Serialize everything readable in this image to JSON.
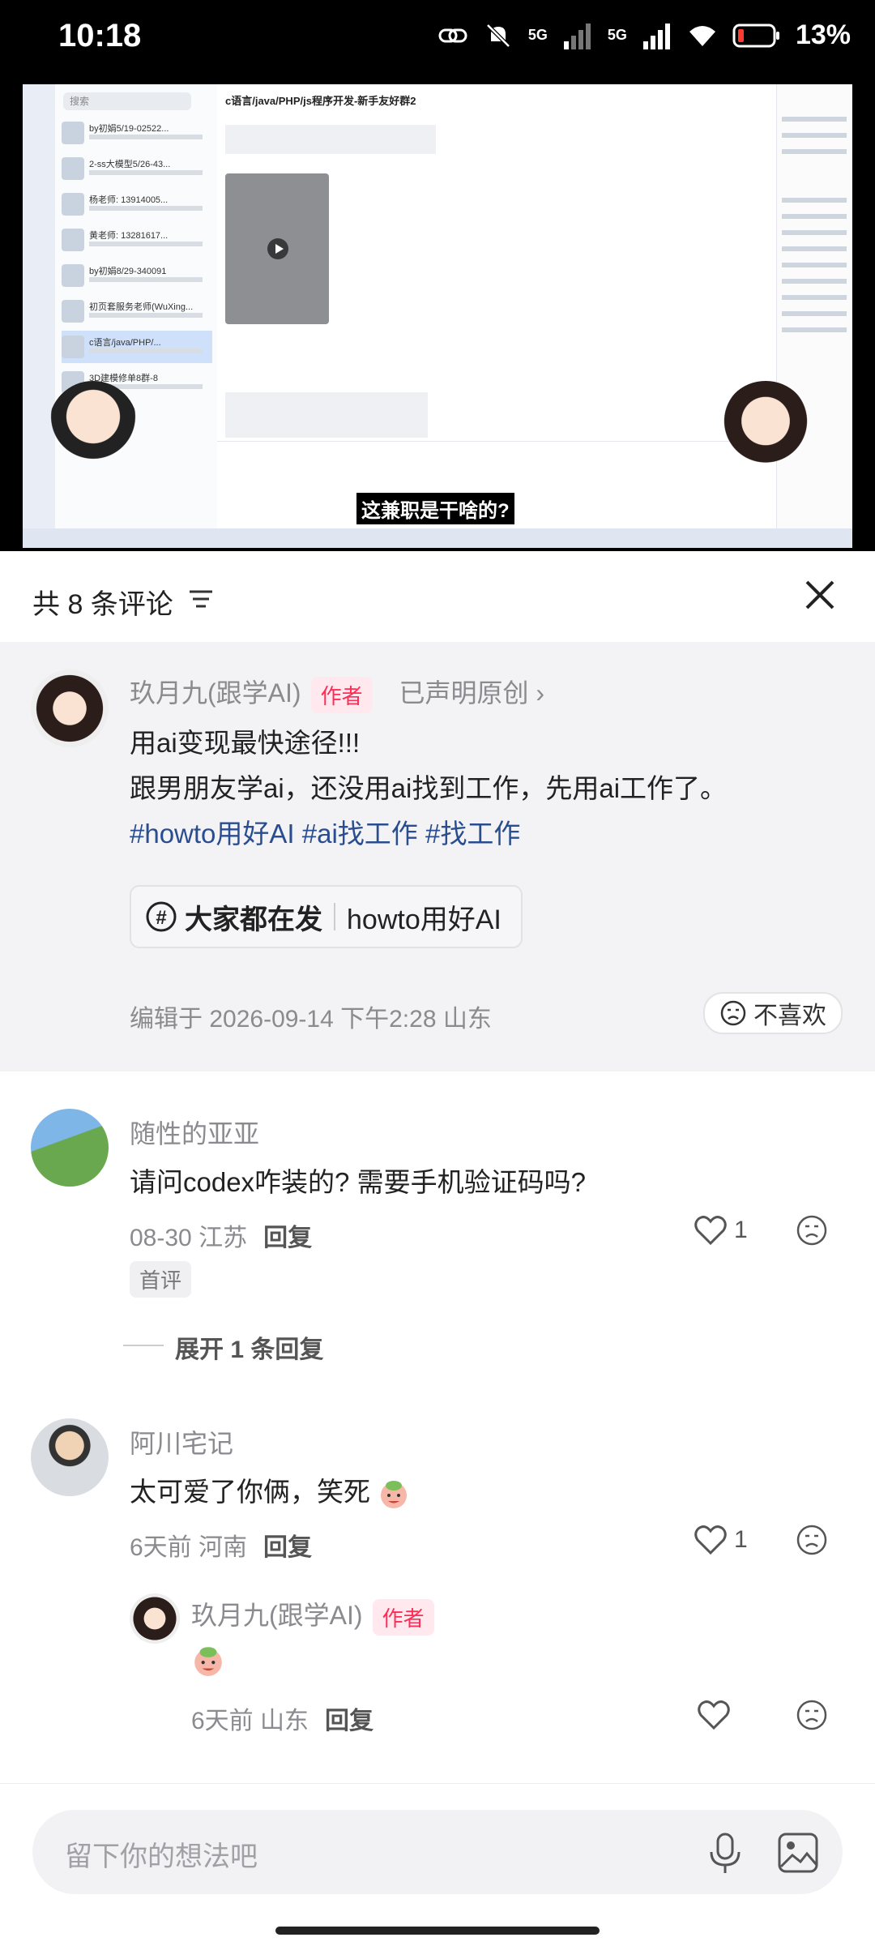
{
  "status_bar": {
    "time": "10:18",
    "battery": "13%",
    "network_1": "5G",
    "network_2": "5G"
  },
  "video": {
    "caption": "这兼职是干啥的?",
    "screen": {
      "search_placeholder": "搜索",
      "window_title": "c语言/java/PHP/js程序开发-新手友好群2",
      "chats": [
        "by初娟5/19-02522...",
        "2-ss大模型5/26-43...",
        "杨老师: 13914005...",
        "黄老师: 13281617...",
        "by初娟8/29-340091",
        "初页套服务老师(WuXing...",
        "c语言/java/PHP/...",
        "3D建模修单8群-8"
      ]
    }
  },
  "comments_panel": {
    "title": "共 8 条评论",
    "post": {
      "author": "玖月九(跟学AI)",
      "author_tag": "作者",
      "original_label": "已声明原创",
      "line1": "用ai变现最快途径!!!",
      "line2": "跟男朋友学ai，还没用ai找到工作，先用ai工作了。",
      "hashtags": "#howto用好AI #ai找工作 #找工作",
      "chip_bold": "大家都在发",
      "chip_topic": "howto用好AI",
      "edited": "编辑于 2026-09-14 下午2:28 山东",
      "dislike_label": "不喜欢"
    },
    "comments": [
      {
        "user": "随性的亚亚",
        "text": "请问codex咋装的? 需要手机验证码吗?",
        "meta": "08-30 江苏",
        "reply_label": "回复",
        "likes": "1",
        "badge": "首评",
        "expand": "展开 1 条回复"
      },
      {
        "user": "阿川宅记",
        "text": "太可爱了你俩，笑死",
        "meta": "6天前 河南",
        "reply_label": "回复",
        "likes": "1"
      }
    ],
    "reply": {
      "user": "玖月九(跟学AI)",
      "author_tag": "作者",
      "meta": "6天前 山东",
      "reply_label": "回复"
    }
  },
  "input": {
    "placeholder": "留下你的想法吧"
  },
  "colors": {
    "author_tag": "#ff2c55",
    "hashtag": "#2a4d8f",
    "post_bg": "#f3f3f5"
  }
}
